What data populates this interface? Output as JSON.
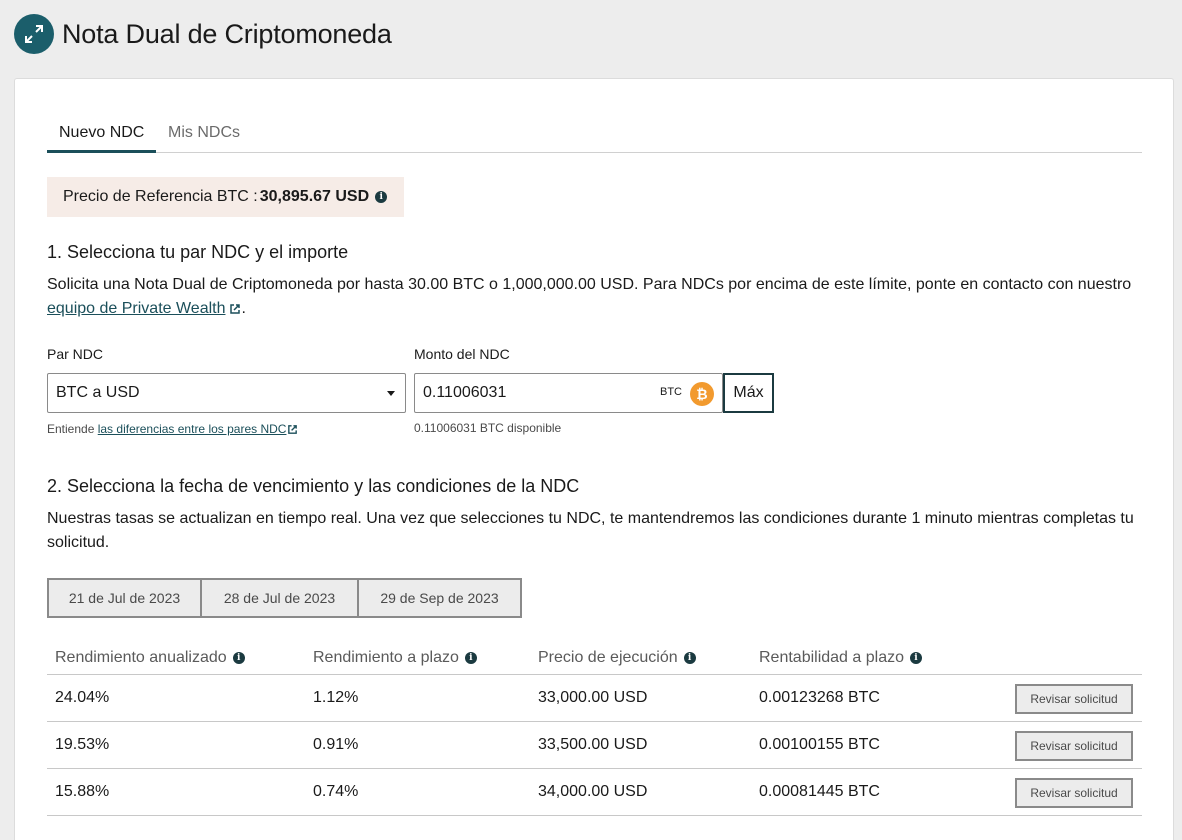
{
  "header": {
    "title": "Nota Dual de Criptomoneda",
    "icon": "expand-arrows-icon"
  },
  "tabs": [
    {
      "label": "Nuevo NDC",
      "active": true
    },
    {
      "label": "Mis NDCs",
      "active": false
    }
  ],
  "reference": {
    "label": "Precio de Referencia BTC :",
    "value": "30,895.67 USD"
  },
  "section1": {
    "title": "1. Selecciona tu par NDC y el importe",
    "text": "Solicita una Nota Dual de Criptomoneda por hasta 30.00 BTC o 1,000,000.00 USD. Para NDCs por encima de este límite, ponte en contacto con nuestro",
    "link": "equipo de Private Wealth",
    "after_link": "."
  },
  "pair": {
    "label": "Par NDC",
    "value": "BTC a USD",
    "help_prefix": "Entiende",
    "help_link": "las diferencias entre los pares NDC"
  },
  "amount": {
    "label": "Monto del NDC",
    "value": "0.11006031",
    "unit": "BTC",
    "max_label": "Máx",
    "available": "0.11006031 BTC disponible"
  },
  "section2": {
    "title": "2. Selecciona la fecha de vencimiento y las condiciones de la NDC",
    "text": "Nuestras tasas se actualizan en tiempo real. Una vez que selecciones tu NDC, te mantendremos las condiciones durante 1 minuto mientras completas tu solicitud."
  },
  "dates": [
    "21 de Jul de 2023",
    "28 de Jul de 2023",
    "29 de Sep de 2023"
  ],
  "table": {
    "headers": [
      "Rendimiento anualizado",
      "Rendimiento a plazo",
      "Precio de ejecución",
      "Rentabilidad a plazo"
    ],
    "rows": [
      {
        "annual": "24.04%",
        "term": "1.12%",
        "strike": "33,000.00 USD",
        "profit": "0.00123268 BTC",
        "action": "Revisar solicitud"
      },
      {
        "annual": "19.53%",
        "term": "0.91%",
        "strike": "33,500.00 USD",
        "profit": "0.00100155 BTC",
        "action": "Revisar solicitud"
      },
      {
        "annual": "15.88%",
        "term": "0.74%",
        "strike": "34,000.00 USD",
        "profit": "0.00081445 BTC",
        "action": "Revisar solicitud"
      }
    ]
  },
  "colors": {
    "accent": "#1b5e6b",
    "ref_bg": "#f6ece7",
    "btc": "#f29a2e"
  }
}
